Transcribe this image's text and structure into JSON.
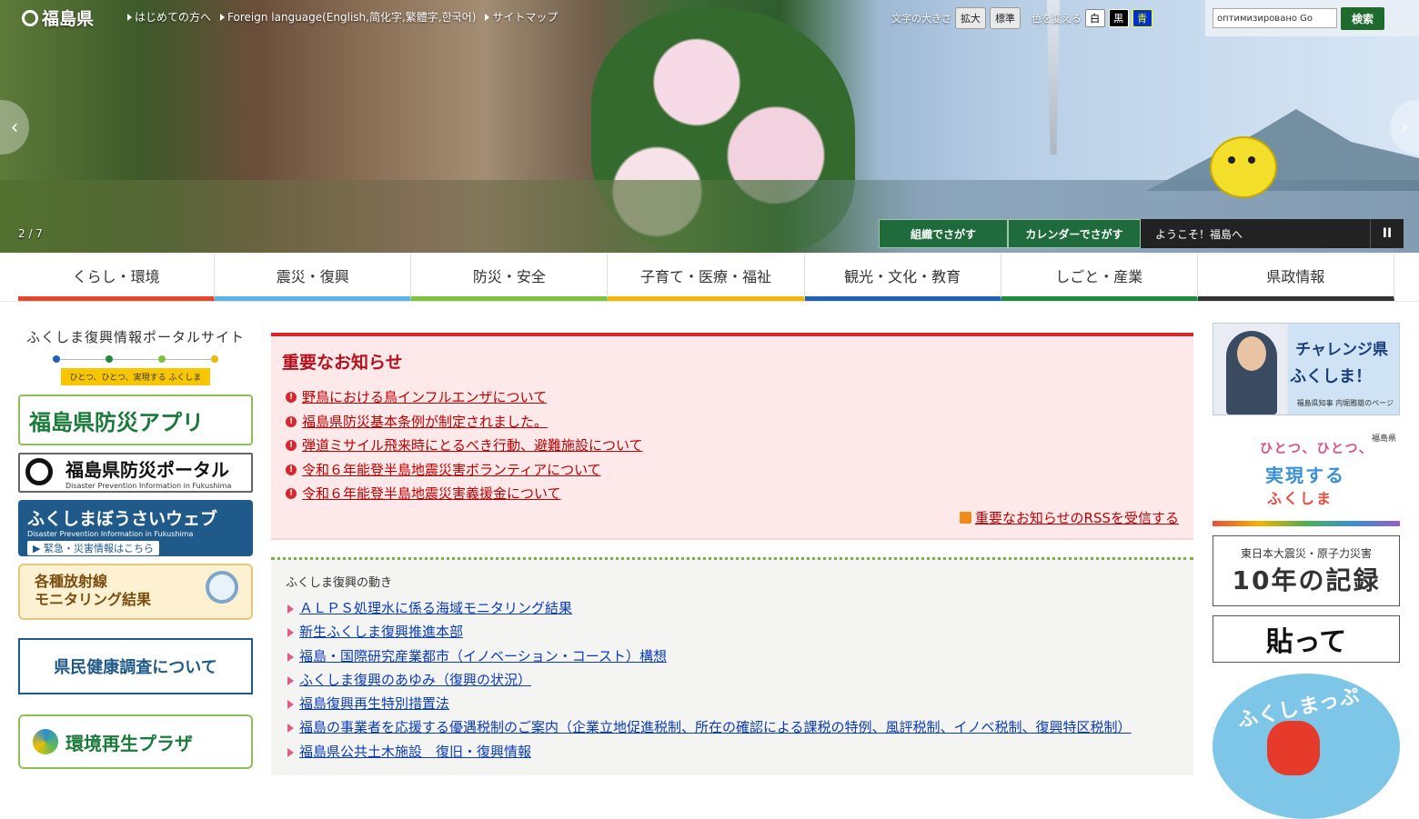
{
  "header": {
    "logo_text": "福島県",
    "links": [
      "はじめての方へ",
      "Foreign language(English,简化字,繁體字,한국어)",
      "サイトマップ"
    ],
    "font_size_label": "文字の大きさ",
    "enlarge": "拡大",
    "standard": "標準",
    "color_label": "色を変える",
    "color_white": "白",
    "color_black": "黒",
    "color_blue": "青",
    "search_value": "оптимизировано Go",
    "search_button": "検索"
  },
  "slider": {
    "counter": "2 / 7",
    "prev": "‹",
    "next": "›",
    "org_search": "組織でさがす",
    "calendar_search": "カレンダーでさがす",
    "welcome": "ようこそ！福島へ",
    "pause": "II"
  },
  "nav": {
    "items": [
      {
        "label": "くらし・環境",
        "color": "#e8452c"
      },
      {
        "label": "震災・復興",
        "color": "#5ab4e5"
      },
      {
        "label": "防災・安全",
        "color": "#7cc23a"
      },
      {
        "label": "子育て・医療・福祉",
        "color": "#f2b705"
      },
      {
        "label": "観光・文化・教育",
        "color": "#1f5fb8"
      },
      {
        "label": "しごと・産業",
        "color": "#1f8a3c"
      },
      {
        "label": "県政情報",
        "color": "#333333"
      }
    ]
  },
  "left": {
    "portal_title": "ふくしま復興情報ポータルサイト",
    "portal_slogan": "ひとつ、ひとつ、実現する ふくしま",
    "app_banner": "福島県防災アプリ",
    "portal_banner_main": "福島県防災ポータル",
    "portal_banner_sub": "Disaster Prevention Information in Fukushima",
    "web_main": "ふくしまぼうさいウェブ",
    "web_sub": "Disaster Prevention Information in Fukushima",
    "web_link": "▶ 緊急・災害情報はこちら",
    "radiation_line1": "各種放射線",
    "radiation_line2": "モニタリング結果",
    "health_survey": "県民健康調査について",
    "plaza": "環境再生プラザ"
  },
  "notice": {
    "heading": "重要なお知らせ",
    "items": [
      "野鳥における鳥インフルエンザについて",
      "福島県防災基本条例が制定されました。",
      "弾道ミサイル飛来時にとるべき行動、避難施設について",
      "令和６年能登半島地震災害ボランティアについて",
      "令和６年能登半島地震災害義援金について"
    ],
    "rss": "重要なお知らせのRSSを受信する"
  },
  "fukko": {
    "heading": "ふくしま復興の動き",
    "items": [
      "ＡＬＰＳ処理水に係る海域モニタリング結果",
      "新生ふくしま復興推進本部",
      "福島・国際研究産業都市（イノベーション・コースト）構想",
      "ふくしま復興のあゆみ（復興の状況）",
      "福島復興再生特別措置法",
      "福島の事業者を応援する優遇税制のご案内（企業立地促進税制、所在の確認による課税の特例、風評税制、イノベ税制、復興特区税制）",
      "福島県公共土木施設　復旧・復興情報"
    ]
  },
  "right": {
    "governor_line1": "チャレンジ県",
    "governor_line2": "ふくしま！",
    "governor_line3": "福島県知事 内堀雅雄のページ",
    "hitotsu_ken": "福島県",
    "hitotsu_line1": "ひとつ、ひとつ、",
    "hitotsu_line2": "実現する",
    "hitotsu_line3": "ふくしま",
    "kiroku_line1": "東日本大震災・原子力災害",
    "kiroku_line2": "10年の記録",
    "hatte": "貼って",
    "matsuri": "ふくしまっぷ"
  }
}
